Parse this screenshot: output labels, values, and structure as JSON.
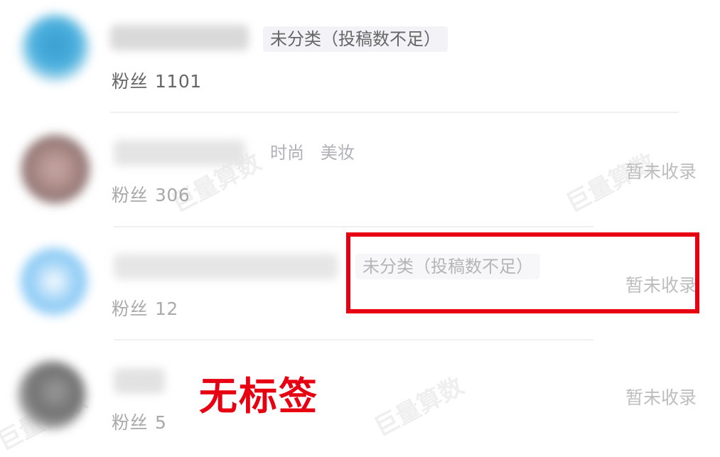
{
  "accounts": [
    {
      "category": "未分类（投稿数不足）",
      "fans_label": "粉丝",
      "fans_count": "1101",
      "status": ""
    },
    {
      "category": "时尚   美妆",
      "fans_label": "粉丝",
      "fans_count": "306",
      "status": "暂未收录"
    },
    {
      "category": "未分类（投稿数不足）",
      "fans_label": "粉丝",
      "fans_count": "12",
      "status": "暂未收录"
    },
    {
      "category": "",
      "fans_label": "粉丝",
      "fans_count": "5",
      "status": "暂未收录"
    }
  ],
  "annotation": {
    "label": "无标签",
    "color": "#e60012"
  },
  "watermark": "巨量算数",
  "colors": {
    "tag_bg_dark": "#f2f2f7",
    "highlight": "#e60012"
  }
}
